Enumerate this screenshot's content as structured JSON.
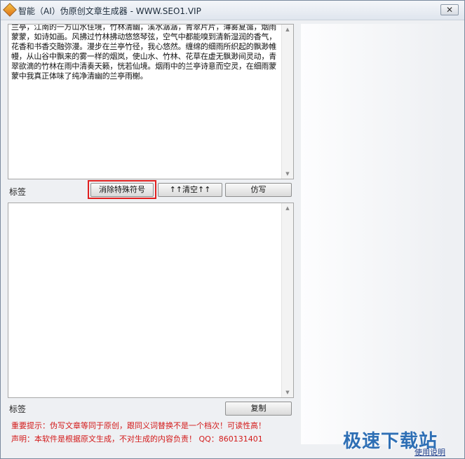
{
  "window": {
    "title": "智能（AI）伪原创文章生成器 - WWW.SEO1.VIP",
    "close_glyph": "✕"
  },
  "input_area": {
    "text": "兰亭，江南的一方山水佳境，竹林清幽，溪水潺潺，青翠片片，薄雾夏霭，烟雨蒙蒙，如诗如画。风拂过竹林拂动悠悠琴弦，空气中都能嗅到清新湿润的香气，花香和书香交融弥漫。漫步在兰亭竹径，我心悠然。缠绵的细雨所织起的飘渺帷幔，从山谷中飘来的雾一样的烟岚，使山水、竹林、花草在虚无飘渺间灵动，青翠欲滴的竹林在雨中清奏天籁，恍若仙境。烟雨中的兰亭诗意而空灵，在细雨蒙蒙中我真正体味了纯净清幽的兰亭雨榭。"
  },
  "labels": {
    "tag_top": "标签",
    "tag_bottom": "标签"
  },
  "buttons": {
    "remove_symbols": "消除特殊符号",
    "clear": "↑↑清空↑↑",
    "rewrite": "仿写",
    "copy": "复制"
  },
  "output_area": {
    "text": ""
  },
  "notices": {
    "important": "重要提示：伪写文章等同于原创，跟同义词替换不是一个档次！可读性高！",
    "statement": "声明：本软件是根据原文生成，不对生成的内容负责！  QQ：860131401"
  },
  "footer": {
    "help_link": "使用说明",
    "watermark": "极速下载站"
  },
  "colors": {
    "notice_red": "#d31a1a",
    "highlight_red": "#e02020",
    "watermark_blue": "#2e6fb5"
  }
}
